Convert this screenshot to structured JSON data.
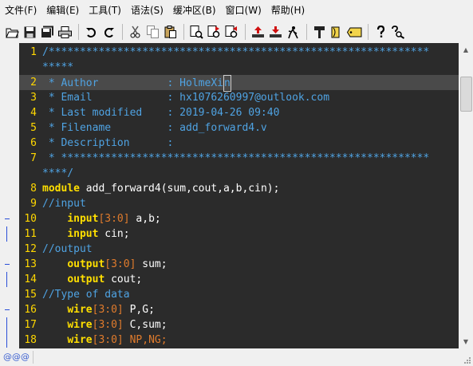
{
  "menubar": {
    "items": [
      "文件(F)",
      "编辑(E)",
      "工具(T)",
      "语法(S)",
      "缓冲区(B)",
      "窗口(W)",
      "帮助(H)"
    ]
  },
  "toolbar": {
    "icons": [
      "open-file-icon",
      "save-icon",
      "save-all-icon",
      "print-icon",
      "undo-icon",
      "redo-icon",
      "cut-icon",
      "copy-icon",
      "paste-icon",
      "find-icon",
      "find-next-icon",
      "find-prev-icon",
      "load-session-icon",
      "save-session-icon",
      "run-script-icon",
      "make-icon",
      "run-shell-icon",
      "tag-jump-icon",
      "help-icon",
      "find-help-icon"
    ]
  },
  "editor": {
    "lines": [
      {
        "num": "1",
        "segments": [
          {
            "cls": "c-comment",
            "text": "/*************************************************************"
          }
        ]
      },
      {
        "num": "",
        "segments": [
          {
            "cls": "c-comment",
            "text": "*****"
          }
        ]
      },
      {
        "num": "2",
        "highlight": true,
        "segments": [
          {
            "cls": "c-comment",
            "text": " * Author           : HolmeXi"
          },
          {
            "cls": "c-comment",
            "text": "n",
            "caret": true
          }
        ]
      },
      {
        "num": "3",
        "segments": [
          {
            "cls": "c-comment",
            "text": " * Email            : hx1076260997@outlook.com"
          }
        ]
      },
      {
        "num": "4",
        "segments": [
          {
            "cls": "c-comment",
            "text": " * Last modified    : 2019-04-26 09:40"
          }
        ]
      },
      {
        "num": "5",
        "segments": [
          {
            "cls": "c-comment",
            "text": " * Filename         : add_forward4.v"
          }
        ]
      },
      {
        "num": "6",
        "segments": [
          {
            "cls": "c-comment",
            "text": " * Description      :"
          }
        ]
      },
      {
        "num": "7",
        "segments": [
          {
            "cls": "c-comment",
            "text": " * ***********************************************************"
          }
        ]
      },
      {
        "num": "",
        "segments": [
          {
            "cls": "c-comment",
            "text": "****/"
          }
        ]
      },
      {
        "num": "8",
        "segments": [
          {
            "cls": "c-kw",
            "text": "module"
          },
          {
            "cls": "c-text",
            "text": " add_forward4(sum,cout,a,b,cin);"
          }
        ]
      },
      {
        "num": "9",
        "segments": [
          {
            "cls": "c-comment",
            "text": "//input"
          }
        ]
      },
      {
        "num": "10",
        "fold": "dash",
        "segments": [
          {
            "cls": "c-plain",
            "text": "    "
          },
          {
            "cls": "c-kw",
            "text": "input"
          },
          {
            "cls": "c-num",
            "text": "[3:0]"
          },
          {
            "cls": "c-text",
            "text": " a,b;"
          }
        ]
      },
      {
        "num": "11",
        "fold": "bar",
        "segments": [
          {
            "cls": "c-plain",
            "text": "    "
          },
          {
            "cls": "c-kw",
            "text": "input"
          },
          {
            "cls": "c-text",
            "text": " cin;"
          }
        ]
      },
      {
        "num": "12",
        "segments": [
          {
            "cls": "c-comment",
            "text": "//output"
          }
        ]
      },
      {
        "num": "13",
        "fold": "dash",
        "segments": [
          {
            "cls": "c-plain",
            "text": "    "
          },
          {
            "cls": "c-kw",
            "text": "output"
          },
          {
            "cls": "c-num",
            "text": "[3:0]"
          },
          {
            "cls": "c-text",
            "text": " sum;"
          }
        ]
      },
      {
        "num": "14",
        "fold": "bar",
        "segments": [
          {
            "cls": "c-plain",
            "text": "    "
          },
          {
            "cls": "c-kw",
            "text": "output"
          },
          {
            "cls": "c-text",
            "text": " cout;"
          }
        ]
      },
      {
        "num": "15",
        "segments": [
          {
            "cls": "c-comment",
            "text": "//Type of data"
          }
        ]
      },
      {
        "num": "16",
        "fold": "dash",
        "segments": [
          {
            "cls": "c-plain",
            "text": "    "
          },
          {
            "cls": "c-kw",
            "text": "wire"
          },
          {
            "cls": "c-num",
            "text": "[3:0]"
          },
          {
            "cls": "c-text",
            "text": " P,G;"
          }
        ]
      },
      {
        "num": "17",
        "fold": "bar",
        "segments": [
          {
            "cls": "c-plain",
            "text": "    "
          },
          {
            "cls": "c-kw",
            "text": "wire"
          },
          {
            "cls": "c-num",
            "text": "[3:0]"
          },
          {
            "cls": "c-text",
            "text": " C,sum;"
          }
        ]
      },
      {
        "num": "18",
        "fold": "bar",
        "segments": [
          {
            "cls": "c-plain",
            "text": "    "
          },
          {
            "cls": "c-kw",
            "text": "wire"
          },
          {
            "cls": "c-num",
            "text": "[3:0]"
          },
          {
            "cls": "c-num",
            "text": " NP,NG;"
          }
        ]
      }
    ]
  },
  "statusbar": {
    "text": "@@@"
  }
}
